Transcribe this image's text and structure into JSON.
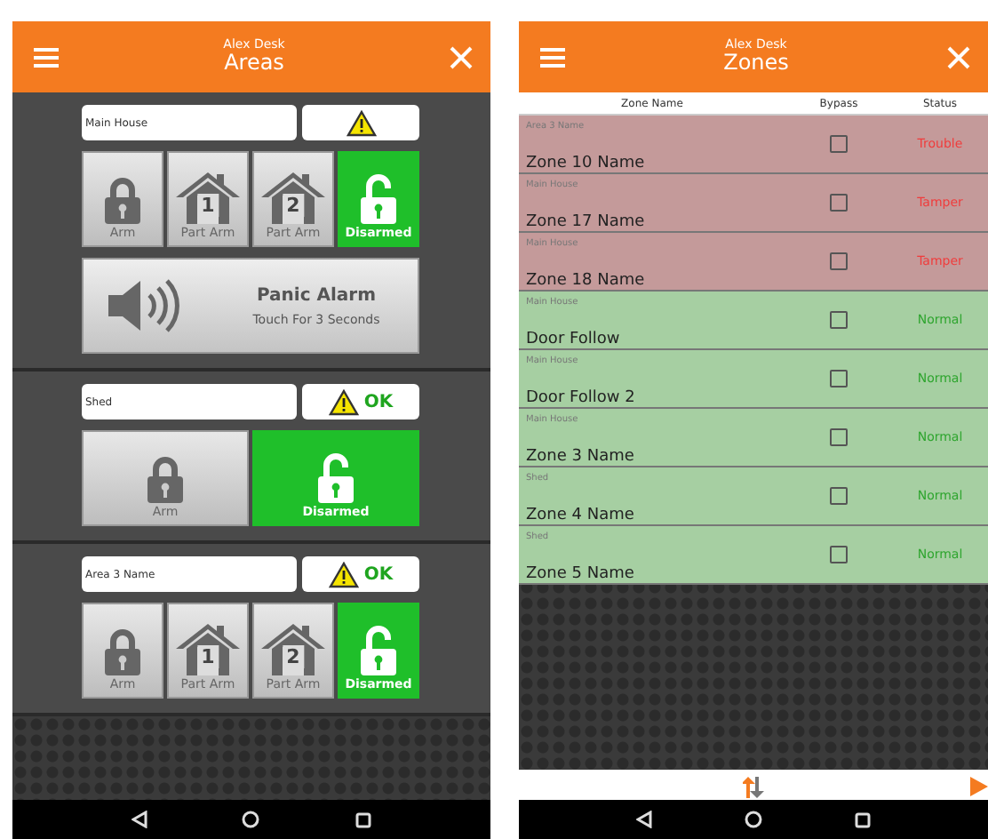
{
  "areas_screen": {
    "header": {
      "subtitle": "Alex Desk",
      "title": "Areas"
    },
    "areas": [
      {
        "name": "Main House",
        "status": {
          "warning": true
        },
        "buttons": [
          {
            "kind": "arm",
            "label": "Arm",
            "selected": false
          },
          {
            "kind": "part_arm",
            "number": "1",
            "label": "Part Arm",
            "selected": false
          },
          {
            "kind": "part_arm",
            "number": "2",
            "label": "Part Arm",
            "selected": false
          },
          {
            "kind": "disarm",
            "label": "Disarmed",
            "selected": true
          }
        ],
        "panic": {
          "title": "Panic Alarm",
          "subtitle": "Touch For 3 Seconds"
        }
      },
      {
        "name": "Shed",
        "status": {
          "warning": true,
          "text": "OK"
        },
        "buttons": [
          {
            "kind": "arm",
            "label": "Arm",
            "selected": false
          },
          {
            "kind": "disarm",
            "label": "Disarmed",
            "selected": true
          }
        ]
      },
      {
        "name": "Area 3 Name",
        "status": {
          "warning": true,
          "text": "OK"
        },
        "buttons": [
          {
            "kind": "arm",
            "label": "Arm",
            "selected": false
          },
          {
            "kind": "part_arm",
            "number": "1",
            "label": "Part Arm",
            "selected": false
          },
          {
            "kind": "part_arm",
            "number": "2",
            "label": "Part Arm",
            "selected": false
          },
          {
            "kind": "disarm",
            "label": "Disarmed",
            "selected": true
          }
        ]
      }
    ]
  },
  "zones_screen": {
    "header": {
      "subtitle": "Alex Desk",
      "title": "Zones"
    },
    "columns": [
      "Zone Name",
      "Bypass",
      "Status"
    ],
    "zones": [
      {
        "area": "Area 3 Name",
        "name": "Zone 10 Name",
        "bypass": false,
        "status": "Trouble",
        "alarm": true
      },
      {
        "area": "Main House",
        "name": "Zone 17 Name",
        "bypass": false,
        "status": "Tamper",
        "alarm": true
      },
      {
        "area": "Main House",
        "name": "Zone 18 Name",
        "bypass": false,
        "status": "Tamper",
        "alarm": true
      },
      {
        "area": "Main House",
        "name": "Door Follow",
        "bypass": false,
        "status": "Normal",
        "alarm": false
      },
      {
        "area": "Main House",
        "name": "Door Follow 2",
        "bypass": false,
        "status": "Normal",
        "alarm": false
      },
      {
        "area": "Main House",
        "name": "Zone 3 Name",
        "bypass": false,
        "status": "Normal",
        "alarm": false
      },
      {
        "area": "Shed",
        "name": "Zone 4 Name",
        "bypass": false,
        "status": "Normal",
        "alarm": false
      },
      {
        "area": "Shed",
        "name": "Zone 5 Name",
        "bypass": false,
        "status": "Normal",
        "alarm": false
      }
    ]
  }
}
